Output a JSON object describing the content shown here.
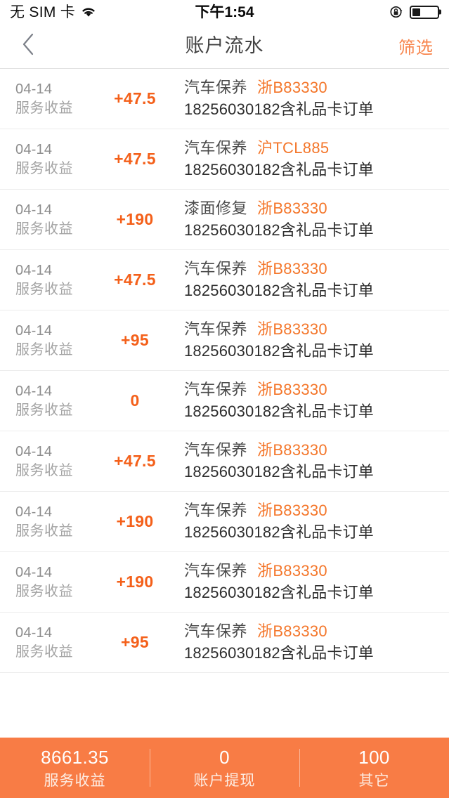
{
  "status_bar": {
    "carrier": "无 SIM 卡",
    "wifi_icon": "wifi-icon",
    "time": "下午1:54",
    "rotation_lock_icon": "rotation-lock-icon",
    "battery_icon": "battery-icon",
    "battery_level_percent": 31
  },
  "nav": {
    "back_icon": "chevron-left-icon",
    "title": "账户流水",
    "filter_label": "筛选"
  },
  "colors": {
    "accent_bar": "#F87C45",
    "amount_text": "#F4601A",
    "plate_text": "#F4762A",
    "filter_text": "#F8864E",
    "title_text": "#434343",
    "separator": "#ECECEC"
  },
  "transactions": [
    {
      "date": "04-14",
      "type": "服务收益",
      "amount": "+47.5",
      "service": "汽车保养",
      "plate": "浙B83330",
      "description": "18256030182含礼品卡订单"
    },
    {
      "date": "04-14",
      "type": "服务收益",
      "amount": "+47.5",
      "service": "汽车保养",
      "plate": "沪TCL885",
      "description": "18256030182含礼品卡订单"
    },
    {
      "date": "04-14",
      "type": "服务收益",
      "amount": "+190",
      "service": "漆面修复",
      "plate": "浙B83330",
      "description": "18256030182含礼品卡订单"
    },
    {
      "date": "04-14",
      "type": "服务收益",
      "amount": "+47.5",
      "service": "汽车保养",
      "plate": "浙B83330",
      "description": "18256030182含礼品卡订单"
    },
    {
      "date": "04-14",
      "type": "服务收益",
      "amount": "+95",
      "service": "汽车保养",
      "plate": "浙B83330",
      "description": "18256030182含礼品卡订单"
    },
    {
      "date": "04-14",
      "type": "服务收益",
      "amount": "0",
      "service": "汽车保养",
      "plate": "浙B83330",
      "description": "18256030182含礼品卡订单"
    },
    {
      "date": "04-14",
      "type": "服务收益",
      "amount": "+47.5",
      "service": "汽车保养",
      "plate": "浙B83330",
      "description": "18256030182含礼品卡订单"
    },
    {
      "date": "04-14",
      "type": "服务收益",
      "amount": "+190",
      "service": "汽车保养",
      "plate": "浙B83330",
      "description": "18256030182含礼品卡订单"
    },
    {
      "date": "04-14",
      "type": "服务收益",
      "amount": "+190",
      "service": "汽车保养",
      "plate": "浙B83330",
      "description": "18256030182含礼品卡订单"
    },
    {
      "date": "04-14",
      "type": "服务收益",
      "amount": "+95",
      "service": "汽车保养",
      "plate": "浙B83330",
      "description": "18256030182含礼品卡订单"
    }
  ],
  "summary": [
    {
      "value": "8661.35",
      "label": "服务收益"
    },
    {
      "value": "0",
      "label": "账户提现"
    },
    {
      "value": "100",
      "label": "其它"
    }
  ]
}
